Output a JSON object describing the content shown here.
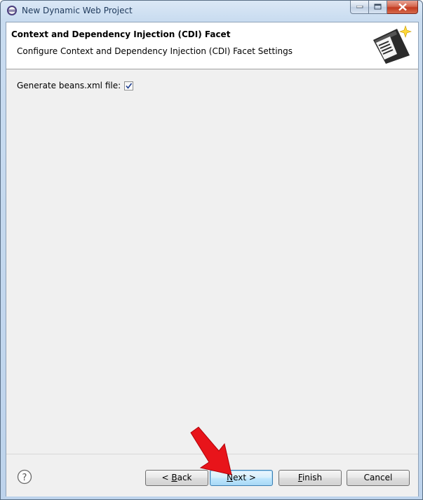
{
  "window": {
    "title": "New Dynamic Web Project",
    "app_icon": "eclipse-icon",
    "controls": [
      "minimize-icon",
      "maximize-icon",
      "close-icon"
    ]
  },
  "banner": {
    "title": "Context and Dependency Injection (CDI) Facet",
    "description": "Configure Context and Dependency Injection (CDI) Facet Settings",
    "image": "wizard-banner-icon"
  },
  "settings": {
    "beans_label": "Generate beans.xml file:",
    "beans_checked": true
  },
  "buttons": {
    "help_icon": "help-icon",
    "back_pre": "< ",
    "back_mn": "B",
    "back_post": "ack",
    "next_mn": "N",
    "next_post": "ext >",
    "finish_mn": "F",
    "finish_post": "inish",
    "cancel": "Cancel"
  },
  "annotation": {
    "arrow_color": "#e8141a"
  }
}
